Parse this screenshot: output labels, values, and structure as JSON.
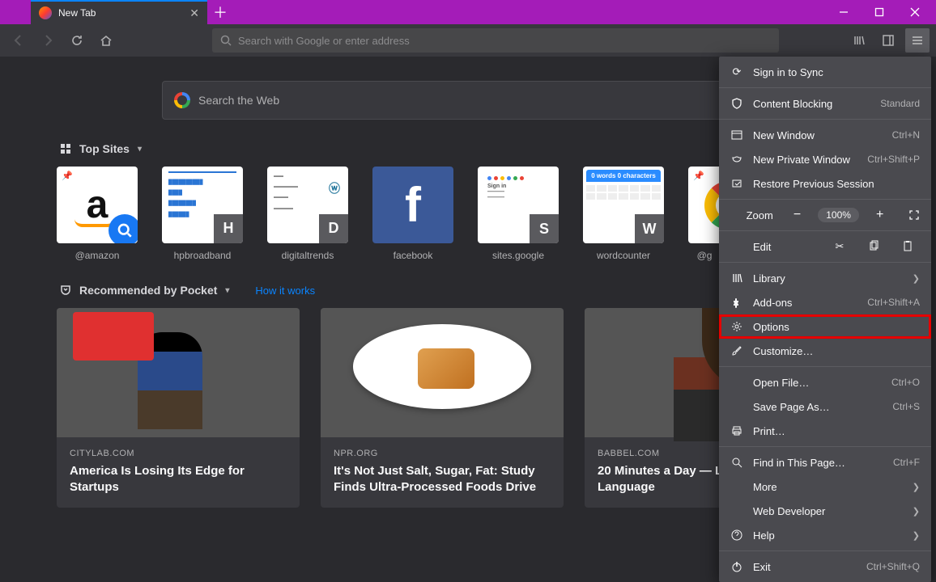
{
  "window": {
    "tab_title": "New Tab"
  },
  "urlbar": {
    "placeholder": "Search with Google or enter address"
  },
  "searchweb": {
    "placeholder": "Search the Web"
  },
  "sections": {
    "topsites": "Top Sites",
    "pocket": "Recommended by Pocket",
    "howit": "How it works"
  },
  "topsites": [
    {
      "label": "@amazon",
      "badge": ""
    },
    {
      "label": "hpbroadband",
      "badge": "H"
    },
    {
      "label": "digitaltrends",
      "badge": "D"
    },
    {
      "label": "facebook",
      "badge": ""
    },
    {
      "label": "sites.google",
      "badge": "S"
    },
    {
      "label": "wordcounter",
      "badge": "W"
    },
    {
      "label": "@g",
      "badge": ""
    }
  ],
  "pocket": [
    {
      "source": "CITYLAB.COM",
      "headline": "America Is Losing Its Edge for Startups"
    },
    {
      "source": "NPR.ORG",
      "headline": "It's Not Just Salt, Sugar, Fat: Study Finds Ultra-Processed Foods Drive"
    },
    {
      "source": "BABBEL.COM",
      "headline": "20 Minutes a Day — Learn a Language"
    }
  ],
  "menu": {
    "sign_in": "Sign in to Sync",
    "content_blocking": "Content Blocking",
    "content_blocking_state": "Standard",
    "new_window": "New Window",
    "new_window_sc": "Ctrl+N",
    "new_private": "New Private Window",
    "new_private_sc": "Ctrl+Shift+P",
    "restore": "Restore Previous Session",
    "zoom": "Zoom",
    "zoom_pct": "100%",
    "edit": "Edit",
    "library": "Library",
    "addons": "Add-ons",
    "addons_sc": "Ctrl+Shift+A",
    "options": "Options",
    "customize": "Customize…",
    "open_file": "Open File…",
    "open_file_sc": "Ctrl+O",
    "save_page": "Save Page As…",
    "save_page_sc": "Ctrl+S",
    "print": "Print…",
    "find": "Find in This Page…",
    "find_sc": "Ctrl+F",
    "more": "More",
    "webdev": "Web Developer",
    "help": "Help",
    "exit": "Exit",
    "exit_sc": "Ctrl+Shift+Q"
  }
}
